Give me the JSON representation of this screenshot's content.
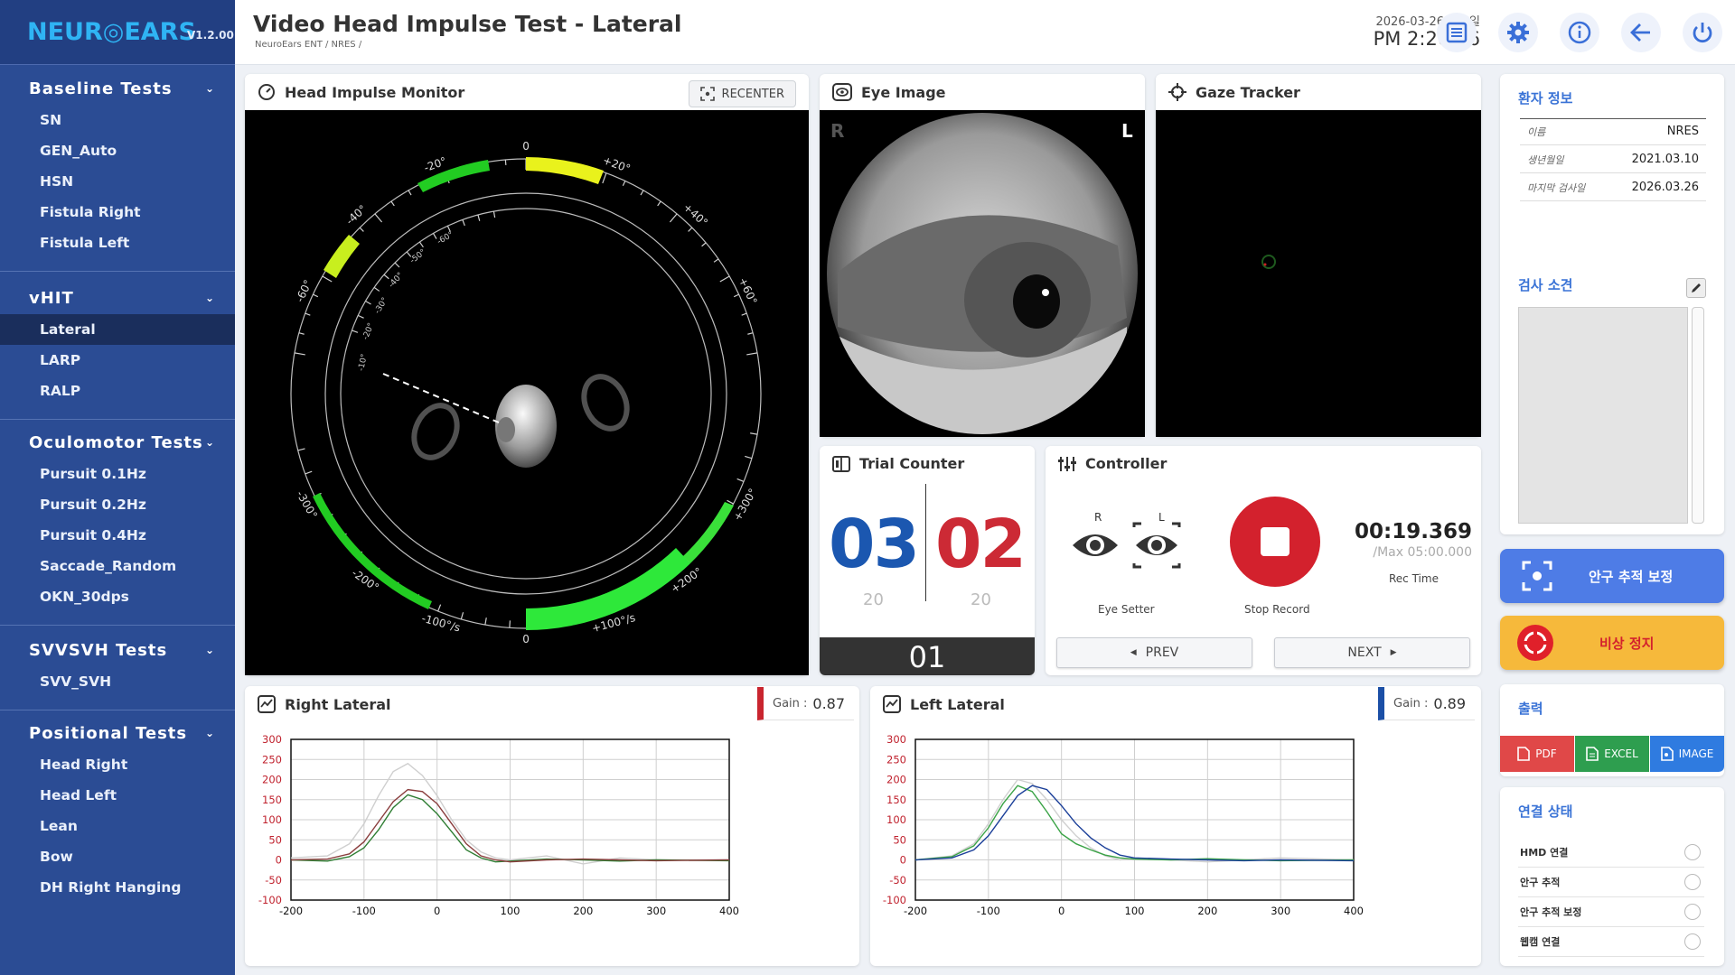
{
  "app": {
    "brand": "NEUR◎EARS",
    "version": "V1.2.00"
  },
  "sidebar": {
    "sections": [
      {
        "title": "Baseline Tests",
        "items": [
          "SN",
          "GEN_Auto",
          "HSN",
          "Fistula Right",
          "Fistula Left"
        ]
      },
      {
        "title": "vHIT",
        "items": [
          "Lateral",
          "LARP",
          "RALP"
        ]
      },
      {
        "title": "Oculomotor Tests",
        "items": [
          "Pursuit 0.1Hz",
          "Pursuit 0.2Hz",
          "Pursuit 0.4Hz",
          "Saccade_Random",
          "OKN_30dps"
        ]
      },
      {
        "title": "SVVSVH Tests",
        "items": [
          "SVV_SVH"
        ]
      },
      {
        "title": "Positional Tests",
        "items": [
          "Head Right",
          "Head Left",
          "Lean",
          "Bow",
          "DH Right Hanging"
        ]
      }
    ],
    "active_item": "Lateral"
  },
  "header": {
    "title": "Video Head Impulse Test - Lateral",
    "breadcrumb": "NeuroEars ENT / NRES /",
    "date": "2026-03-26 목요일",
    "time": "PM 2:20:26",
    "icons": [
      "list-icon",
      "gear-icon",
      "info-icon",
      "back-arrow-icon",
      "power-icon"
    ]
  },
  "monitor": {
    "title": "Head Impulse Monitor",
    "recenter_label": "RECENTER",
    "dial_labels": {
      "top0": "0",
      "p20": "+20°",
      "m20": "-20°",
      "p40": "+40°",
      "m40": "-40°",
      "p60": "+60°",
      "m60": "-60°",
      "m300": "-300°",
      "p300": "+300°",
      "m200": "-200°",
      "p200": "+200°",
      "m100": "-100°/s",
      "p100": "+100°/s",
      "bot0": "0",
      "i60": "-60°",
      "i50": "-50°",
      "i40": "-40°",
      "i30": "-30°",
      "i20": "-20°",
      "i10": "-10°"
    }
  },
  "eye_image": {
    "title": "Eye Image",
    "left_tag": "R",
    "right_tag": "L"
  },
  "gaze": {
    "title": "Gaze Tracker"
  },
  "trial": {
    "title": "Trial Counter",
    "left_count": "03",
    "left_total": "20",
    "right_count": "02",
    "right_total": "20",
    "current": "01"
  },
  "controller": {
    "title": "Controller",
    "eye_setter_label": "Eye Setter",
    "eye_r": "R",
    "eye_l": "L",
    "stop_label": "Stop Record",
    "timer": "00:19.369",
    "timer_max": "/Max 05:00.000",
    "rec_time_label": "Rec Time",
    "prev_label": "PREV",
    "next_label": "NEXT"
  },
  "charts_meta": {
    "right": {
      "title": "Right Lateral",
      "gain_label": "Gain :",
      "gain_value": "0.87",
      "accent": "#c9252f"
    },
    "left": {
      "title": "Left Lateral",
      "gain_label": "Gain :",
      "gain_value": "0.89",
      "accent": "#1b4fa6"
    }
  },
  "chart_data": [
    {
      "type": "line",
      "title": "Right Lateral",
      "xlim": [
        -200,
        400
      ],
      "ylim": [
        -100,
        300
      ],
      "x_ticks": [
        -200,
        -100,
        0,
        100,
        200,
        300,
        400
      ],
      "y_ticks": [
        300,
        250,
        200,
        150,
        100,
        50,
        0,
        -50,
        -100
      ],
      "x": [
        -200,
        -150,
        -120,
        -100,
        -80,
        -60,
        -40,
        -20,
        0,
        20,
        40,
        60,
        80,
        100,
        150,
        200,
        250,
        300,
        400
      ],
      "series": [
        {
          "color": "#8a3d3d",
          "values": [
            0,
            2,
            15,
            45,
            95,
            145,
            175,
            170,
            140,
            90,
            40,
            10,
            0,
            -5,
            0,
            2,
            0,
            -2,
            0
          ]
        },
        {
          "color": "#2e7d32",
          "values": [
            0,
            -3,
            8,
            30,
            75,
            130,
            162,
            150,
            115,
            70,
            25,
            5,
            -5,
            -3,
            2,
            0,
            -3,
            0,
            -2
          ]
        },
        {
          "color": "#cfcfcf",
          "values": [
            5,
            10,
            40,
            90,
            160,
            220,
            240,
            210,
            160,
            100,
            50,
            20,
            5,
            0,
            10,
            -10,
            5,
            0,
            0
          ]
        }
      ]
    },
    {
      "type": "line",
      "title": "Left Lateral",
      "xlim": [
        -200,
        400
      ],
      "ylim": [
        -100,
        300
      ],
      "x_ticks": [
        -200,
        -100,
        0,
        100,
        200,
        300,
        400
      ],
      "y_ticks": [
        300,
        250,
        200,
        150,
        100,
        50,
        0,
        -50,
        -100
      ],
      "x": [
        -200,
        -150,
        -120,
        -100,
        -80,
        -60,
        -40,
        -20,
        0,
        20,
        40,
        60,
        80,
        100,
        150,
        200,
        250,
        300,
        400
      ],
      "series": [
        {
          "color": "#1b3f99",
          "values": [
            0,
            5,
            25,
            60,
            110,
            160,
            185,
            175,
            135,
            90,
            55,
            30,
            12,
            5,
            2,
            0,
            -2,
            0,
            -2
          ]
        },
        {
          "color": "#3aa346",
          "values": [
            0,
            8,
            35,
            80,
            140,
            185,
            170,
            120,
            65,
            40,
            25,
            12,
            5,
            2,
            0,
            3,
            0,
            -2,
            0
          ]
        },
        {
          "color": "#cfcfcf",
          "values": [
            0,
            10,
            40,
            90,
            150,
            200,
            190,
            150,
            100,
            60,
            30,
            10,
            0,
            5,
            0,
            -5,
            0,
            5,
            0
          ]
        }
      ]
    }
  ],
  "right_panel": {
    "patient_title": "환자 정보",
    "patient_rows": [
      {
        "k": "이름",
        "v": "NRES"
      },
      {
        "k": "생년월일",
        "v": "2021.03.10"
      },
      {
        "k": "마지막 검사일",
        "v": "2026.03.26"
      }
    ],
    "notes_title": "검사 소견",
    "calib_label": "안구 추적 보정",
    "emergency_label": "비상 정지",
    "output_title": "출력",
    "export": [
      "PDF",
      "EXCEL",
      "IMAGE"
    ],
    "conn_title": "연결 상태",
    "conn_items": [
      "HMD 연결",
      "안구 추적",
      "안구 추적 보정",
      "웹캠 연결"
    ]
  },
  "colors": {
    "sidebar": "#2b4c94",
    "accent_blue": "#3a73d6",
    "stop_red": "#d3212d",
    "emergency": "#f6b93b",
    "pdf": "#e04848",
    "excel": "#2e9e4f",
    "image": "#2f7be0"
  }
}
